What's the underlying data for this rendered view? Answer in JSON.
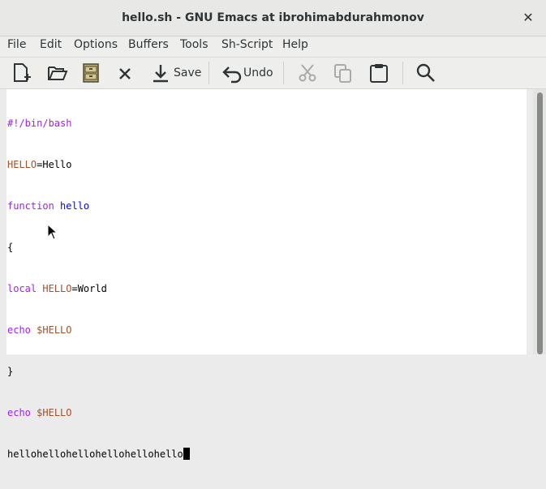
{
  "window": {
    "title": "hello.sh - GNU Emacs at ibrohimabdurahmonov",
    "close_symbol": "✕"
  },
  "menu": [
    "File",
    "Edit",
    "Options",
    "Buffers",
    "Tools",
    "Sh-Script",
    "Help"
  ],
  "toolbar": {
    "new_file": "new-file-icon",
    "open": "open-folder-icon",
    "dired": "dired-cabinet-icon",
    "close": "close-buffer-icon",
    "save_label": "Save",
    "undo_label": "Undo",
    "cut": "cut-icon",
    "copy": "copy-icon",
    "paste": "paste-icon",
    "search": "search-icon"
  },
  "editor": {
    "lines": {
      "l1": "#!/bin/bash",
      "l2_var": "HELLO",
      "l2_rest": "=Hello",
      "l3_kw": "function",
      "l3_fn": "hello",
      "l4": "{",
      "l5_kw": "local",
      "l5_var": "HELLO",
      "l5_rest": "=World",
      "l6_kw": "echo",
      "l6_var": "$HELLO",
      "l7": "}",
      "l8_kw": "echo",
      "l8_var": "$HELLO",
      "l9": "hellohellohellohellohellohello"
    }
  },
  "colors": {
    "keyword": "#a020f0",
    "function_name": "#0000ff",
    "variable": "#a0522d",
    "text": "#000000"
  }
}
